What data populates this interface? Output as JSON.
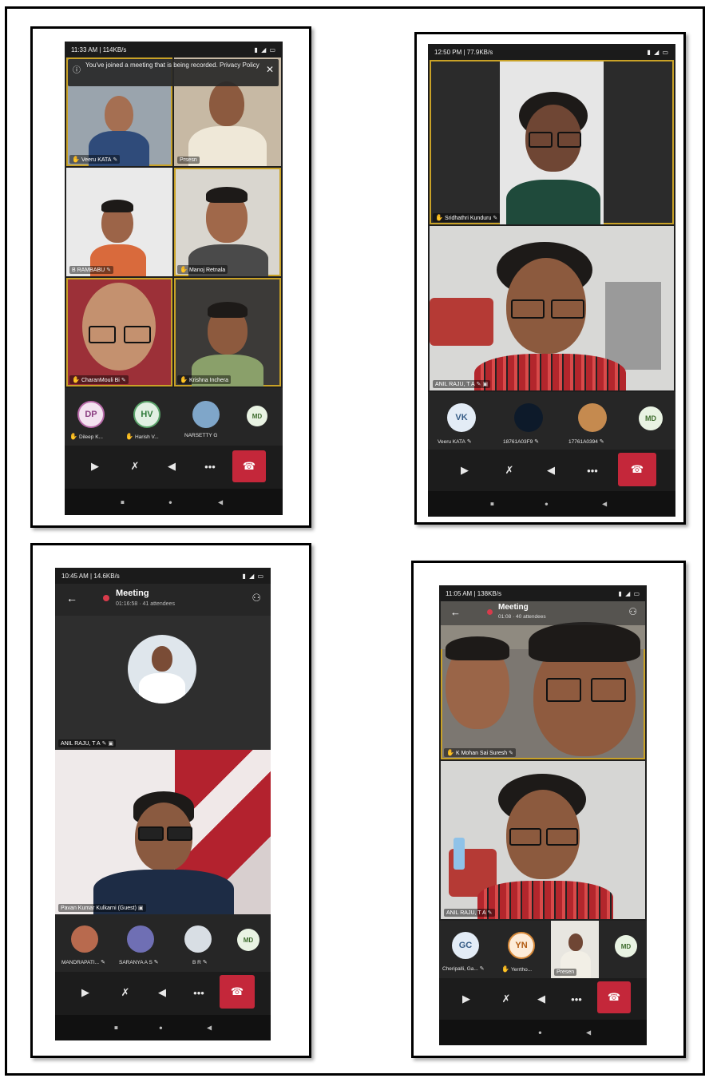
{
  "screen1": {
    "status_time": "11:33 AM | 114KB/s",
    "status_icons": "▲ ◉",
    "banner_text": "You've joined a meeting that is being recorded. Privacy Policy",
    "tiles": [
      {
        "label": "Veeru KATA"
      },
      {
        "label": "Prsesn"
      },
      {
        "label": "B RAMBABU"
      },
      {
        "label": "Manoj Retnala"
      },
      {
        "label": "CharanMouli Bi"
      },
      {
        "label": "Krishna Inchera"
      }
    ],
    "roster": [
      {
        "initials": "DP",
        "name": "Dileep K..."
      },
      {
        "initials": "HV",
        "name": "Harish V..."
      },
      {
        "initials": "",
        "name": "NARSETTY G"
      },
      {
        "initials": "MD",
        "name": ""
      }
    ]
  },
  "screen2": {
    "status_time": "12:50 PM | 77.9KB/s",
    "tiles": [
      {
        "label": "Sridhathri Kunduru"
      },
      {
        "label": "ANIL RAJU, T A"
      }
    ],
    "roster": [
      {
        "initials": "VK",
        "name": "Veeru KATA"
      },
      {
        "initials": "",
        "name": "18761A03F9"
      },
      {
        "initials": "",
        "name": "17761A0394"
      },
      {
        "initials": "MD",
        "name": ""
      }
    ]
  },
  "screen3": {
    "status_time": "10:45 AM | 14.6KB/s",
    "title": "Meeting",
    "subtitle": "01:16:58 · 41 attendees",
    "tiles": [
      {
        "label": "ANIL RAJU, T A"
      },
      {
        "label": "Pavan Kumar Kulkarni (Guest)"
      }
    ],
    "roster": [
      {
        "initials": "",
        "name": "MANDRAPATI..."
      },
      {
        "initials": "",
        "name": "SARANYA A S"
      },
      {
        "initials": "",
        "name": "B R"
      },
      {
        "initials": "MD",
        "name": ""
      }
    ]
  },
  "screen4": {
    "status_time": "11:05 AM | 138KB/s",
    "title": "Meeting",
    "subtitle": "01:08 · 40 attendees",
    "tiles": [
      {
        "label": "K Mohan Sai Suresh"
      },
      {
        "label": "ANIL RAJU, T A"
      }
    ],
    "roster": [
      {
        "initials": "GC",
        "name": "Cheripalli, Ga..."
      },
      {
        "initials": "YN",
        "name": "Yerrtho..."
      },
      {
        "initials": "",
        "name": "Presen"
      },
      {
        "initials": "MD",
        "name": ""
      }
    ]
  },
  "colors": {
    "speaking": "#c9a227",
    "end_call": "#c4273a",
    "hand": "#f2b705"
  }
}
